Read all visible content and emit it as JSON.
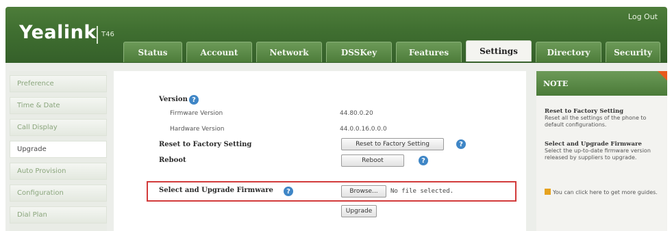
{
  "header": {
    "logo": "Yealink",
    "model": "T46",
    "logout": "Log Out",
    "tabs": [
      {
        "label": "Status"
      },
      {
        "label": "Account"
      },
      {
        "label": "Network"
      },
      {
        "label": "DSSKey"
      },
      {
        "label": "Features"
      },
      {
        "label": "Settings",
        "active": true
      },
      {
        "label": "Directory"
      },
      {
        "label": "Security"
      }
    ]
  },
  "sidebar": {
    "items": [
      {
        "label": "Preference"
      },
      {
        "label": "Time & Date"
      },
      {
        "label": "Call Display"
      },
      {
        "label": "Upgrade",
        "active": true
      },
      {
        "label": "Auto Provision"
      },
      {
        "label": "Configuration"
      },
      {
        "label": "Dial Plan"
      }
    ]
  },
  "main": {
    "version_label": "Version",
    "firmware_label": "Firmware Version",
    "firmware_value": "44.80.0.20",
    "hardware_label": "Hardware Version",
    "hardware_value": "44.0.0.16.0.0.0",
    "reset_label": "Reset to Factory Setting",
    "reset_button": "Reset to Factory Setting",
    "reboot_label": "Reboot",
    "reboot_button": "Reboot",
    "upgrade_label": "Select and Upgrade Firmware",
    "browse_button": "Browse...",
    "file_status": "No file selected.",
    "upgrade_button": "Upgrade"
  },
  "note": {
    "title": "NOTE",
    "reset_title": "Reset to Factory Setting",
    "reset_text": "Reset all the settings of the phone to default configurations.",
    "upgrade_title": "Select and Upgrade Firmware",
    "upgrade_text": "Select the up-to-date firmware version released by suppliers to upgrade.",
    "guide_text": "You can click here to get more guides."
  },
  "colors": {
    "header_green": "#3f6e30",
    "highlight_red": "#d23a3a",
    "help_blue": "#3f86c6",
    "note_accent": "#e85a1c"
  }
}
